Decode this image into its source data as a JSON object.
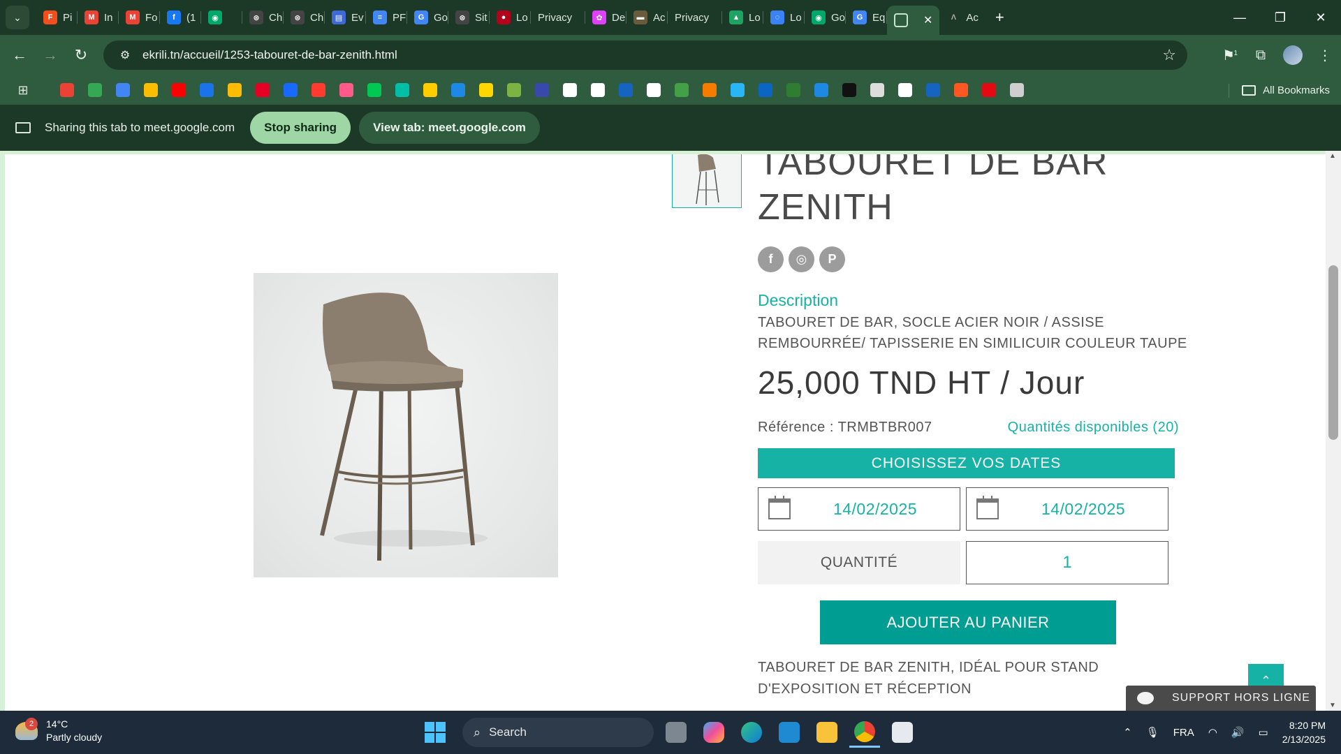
{
  "browser": {
    "tabs": [
      {
        "label": "Pi",
        "color": "#f24e1e",
        "glyph": "F"
      },
      {
        "label": "In",
        "color": "#ea4335",
        "glyph": "M"
      },
      {
        "label": "Fo",
        "color": "#ea4335",
        "glyph": "M"
      },
      {
        "label": "(1",
        "color": "#1877f2",
        "glyph": "f"
      },
      {
        "label": "",
        "color": "#00a86b",
        "glyph": "◉"
      },
      {
        "label": "Ch",
        "color": "#444444",
        "glyph": "⊛"
      },
      {
        "label": "Ch",
        "color": "#444444",
        "glyph": "⊛"
      },
      {
        "label": "Ev",
        "color": "#3d6ad6",
        "glyph": "▤"
      },
      {
        "label": "PF",
        "color": "#4285f4",
        "glyph": "≡"
      },
      {
        "label": "Go",
        "color": "#4285f4",
        "glyph": "G"
      },
      {
        "label": "Sit",
        "color": "#444444",
        "glyph": "⊛"
      },
      {
        "label": "Lo",
        "color": "#b3001b",
        "glyph": "●"
      },
      {
        "label": "Privacy",
        "color": "",
        "glyph": ""
      },
      {
        "label": "De",
        "color": "#e040fb",
        "glyph": "✿"
      },
      {
        "label": "Ac",
        "color": "#6b5b3e",
        "glyph": "▬"
      },
      {
        "label": "Privacy",
        "color": "",
        "glyph": ""
      },
      {
        "label": "Lo",
        "color": "#1ea362",
        "glyph": "▲"
      },
      {
        "label": "Lo",
        "color": "#3b82f6",
        "glyph": "◌"
      },
      {
        "label": "Go",
        "color": "#00a86b",
        "glyph": "◉"
      },
      {
        "label": "Eq",
        "color": "#4285f4",
        "glyph": "G"
      }
    ],
    "active_tab": {
      "label": "",
      "close": "✕"
    },
    "last_tab": {
      "label": "Ac"
    },
    "new_tab": "+",
    "window_controls": {
      "minimize": "—",
      "restore": "❐",
      "close": "✕"
    },
    "url": "ekrili.tn/accueil/1253-tabouret-de-bar-zenith.html",
    "extensions_badge": "1",
    "bookmark_colors": [
      "#ea4335",
      "#34a853",
      "#4285f4",
      "#fbbc04",
      "#ff0000",
      "#1a73e8",
      "#fbbc04",
      "#e60023",
      "#1769ff",
      "#ff3b30",
      "#ff5a8a",
      "#00c853",
      "#00bfa5",
      "#ffcc00",
      "#1e88e5",
      "#ffd600",
      "#7cb342",
      "#3949ab",
      "#ffffff",
      "#ffffff",
      "#1565c0",
      "#ffffff",
      "#43a047",
      "#f57c00",
      "#29b6f6",
      "#0a66c2",
      "#2e7d32",
      "#1e88e5",
      "#111111",
      "#dddddd",
      "#ffffff",
      "#1565c0",
      "#ff5722",
      "#e50914",
      "#cfcfcf"
    ],
    "all_bookmarks": "All Bookmarks",
    "sharing": {
      "text": "Sharing this tab to meet.google.com",
      "stop": "Stop sharing",
      "view": "View tab: meet.google.com"
    }
  },
  "product": {
    "title": "TABOURET DE BAR ZENITH",
    "social": [
      "f",
      "◎",
      "P"
    ],
    "description_heading": "Description",
    "description": "TABOURET DE BAR, SOCLE ACIER NOIR / ASSISE REMBOURRÉE/ TAPISSERIE EN SIMILICUIR COULEUR TAUPE",
    "price": "25,000 TND HT / Jour",
    "reference": "Référence : TRMBTBR007",
    "quantities_available": "Quantités disponibles (20)",
    "choose_dates": "CHOISISSEZ VOS DATES",
    "date_start": "14/02/2025",
    "date_end": "14/02/2025",
    "quantity_label": "QUANTITÉ",
    "quantity_value": "1",
    "add_to_cart": "AJOUTER AU PANIER",
    "long_description": "TABOURET DE BAR ZENITH, IDÉAL POUR STAND D'EXPOSITION ET RÉCEPTION",
    "support": "SUPPORT HORS LIGNE",
    "to_top": "⌃"
  },
  "taskbar": {
    "weather_temp": "14°C",
    "weather_desc": "Partly cloudy",
    "weather_badge": "2",
    "search": "Search",
    "language": "FRA",
    "time": "8:20 PM",
    "date": "2/13/2025"
  }
}
